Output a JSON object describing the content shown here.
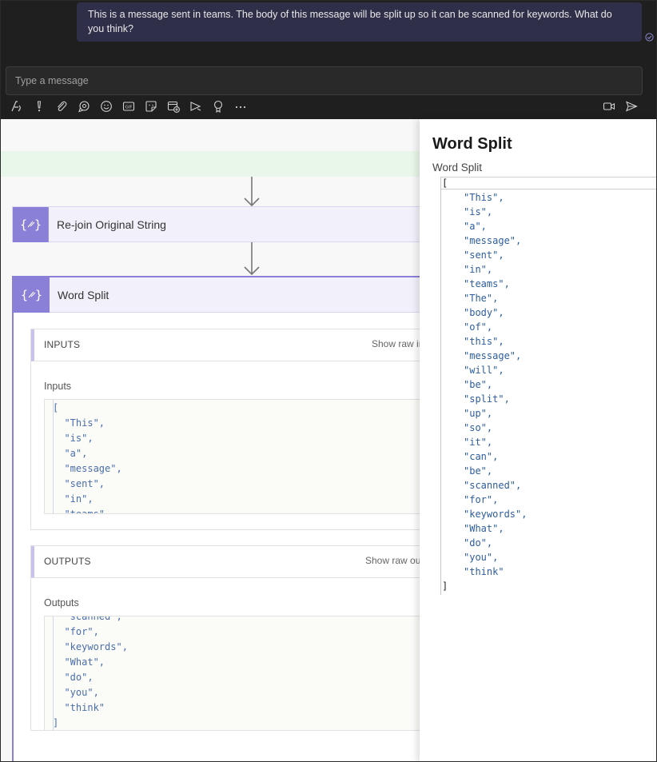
{
  "teams": {
    "message_text": "This is a message sent in teams. The body of this message will be split up so it can be scanned for keywords. What do you think?",
    "compose_placeholder": "Type a message",
    "toolbar_icons": [
      "format-icon",
      "important-icon",
      "attach-icon",
      "loop-icon",
      "emoji-icon",
      "gif-icon",
      "sticker-icon",
      "schedule-meeting-icon",
      "stream-icon",
      "praise-icon",
      "more-icon"
    ],
    "right_icons": [
      "meet-now-icon",
      "send-icon"
    ]
  },
  "flow": {
    "rejoin_title": "Re-join Original String",
    "word_split_title": "Word Split",
    "inputs_header": "INPUTS",
    "inputs_show_raw": "Show raw inputs",
    "inputs_label": "Inputs",
    "inputs_code": "[\n  \"This\",\n  \"is\",\n  \"a\",\n  \"message\",\n  \"sent\",\n  \"in\",\n  \"teams\",",
    "outputs_header": "OUTPUTS",
    "outputs_show_raw": "Show raw outputs",
    "outputs_label": "Outputs",
    "outputs_code": "  \"scanned\",\n  \"for\",\n  \"keywords\",\n  \"What\",\n  \"do\",\n  \"you\",\n  \"think\"\n]"
  },
  "panel": {
    "title": "Word Split",
    "subtitle": "Word Split",
    "open_bracket": "[",
    "close_bracket": "]",
    "words": "\"This\",\n\"is\",\n\"a\",\n\"message\",\n\"sent\",\n\"in\",\n\"teams\",\n\"The\",\n\"body\",\n\"of\",\n\"this\",\n\"message\",\n\"will\",\n\"be\",\n\"split\",\n\"up\",\n\"so\",\n\"it\",\n\"can\",\n\"be\",\n\"scanned\",\n\"for\",\n\"keywords\",\n\"What\",\n\"do\",\n\"you\",\n\"think\""
  },
  "colors": {
    "teams_bg": "#1f1f1f",
    "bubble_bg": "#2f2f4a",
    "accent_purple": "#8b80d8",
    "code_blue": "#4a6ea9"
  }
}
